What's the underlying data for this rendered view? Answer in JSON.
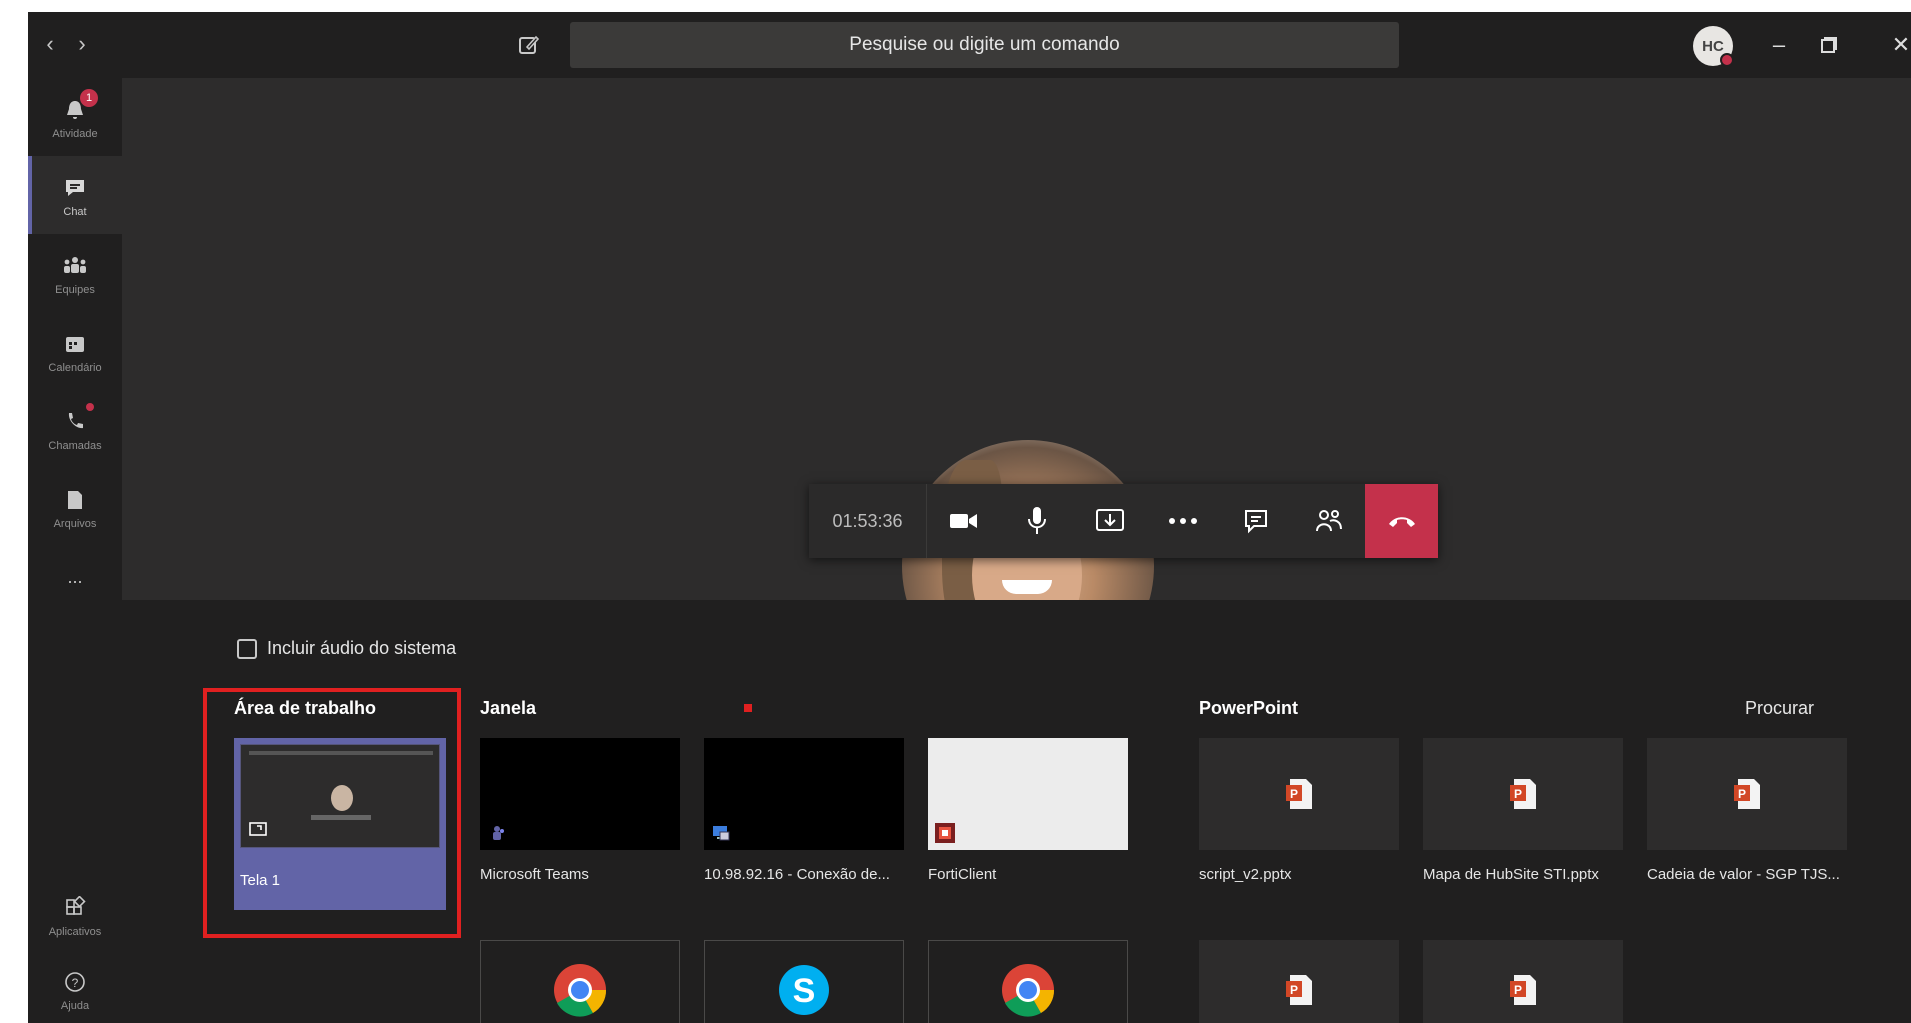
{
  "titlebar": {
    "back_icon": "chevron-left-icon",
    "forward_icon": "chevron-right-icon",
    "search_placeholder": "Pesquise ou digite um comando",
    "avatar_initials": "HC"
  },
  "rail": {
    "items": [
      {
        "label": "Atividade",
        "icon": "bell-icon",
        "badge": "1"
      },
      {
        "label": "Chat",
        "icon": "chat-icon",
        "active": true
      },
      {
        "label": "Equipes",
        "icon": "teams-icon"
      },
      {
        "label": "Calendário",
        "icon": "calendar-icon"
      },
      {
        "label": "Chamadas",
        "icon": "phone-icon"
      },
      {
        "label": "Arquivos",
        "icon": "files-icon"
      },
      {
        "label": "...",
        "icon": "more-icon"
      }
    ],
    "bottom": [
      {
        "label": "Aplicativos",
        "icon": "apps-icon"
      },
      {
        "label": "Ajuda",
        "icon": "help-icon"
      }
    ]
  },
  "callbar": {
    "timer": "01:53:36"
  },
  "share": {
    "system_audio_label": "Incluir áudio do sistema",
    "desktop_title": "Área de trabalho",
    "desktop_screen_name": "Tela 1",
    "window_title": "Janela",
    "powerpoint_title": "PowerPoint",
    "browse_label": "Procurar",
    "windows": [
      {
        "name": "Microsoft Teams",
        "icon": "teams-app-icon"
      },
      {
        "name": "10.98.92.16 - Conexão de...",
        "icon": "remote-desktop-icon"
      },
      {
        "name": "FortiClient",
        "icon": "forticlient-icon"
      }
    ],
    "presentations": [
      {
        "name": "script_v2.pptx"
      },
      {
        "name": "Mapa de HubSite STI.pptx"
      },
      {
        "name": "Cadeia de valor - SGP TJS..."
      }
    ],
    "lower_windows": [
      {
        "icon": "chrome-icon"
      },
      {
        "icon": "skype-icon"
      },
      {
        "icon": "chrome-icon"
      }
    ]
  },
  "colors": {
    "accent": "#6264a7",
    "hangup": "#c4314b",
    "highlight_box": "#e02020"
  }
}
